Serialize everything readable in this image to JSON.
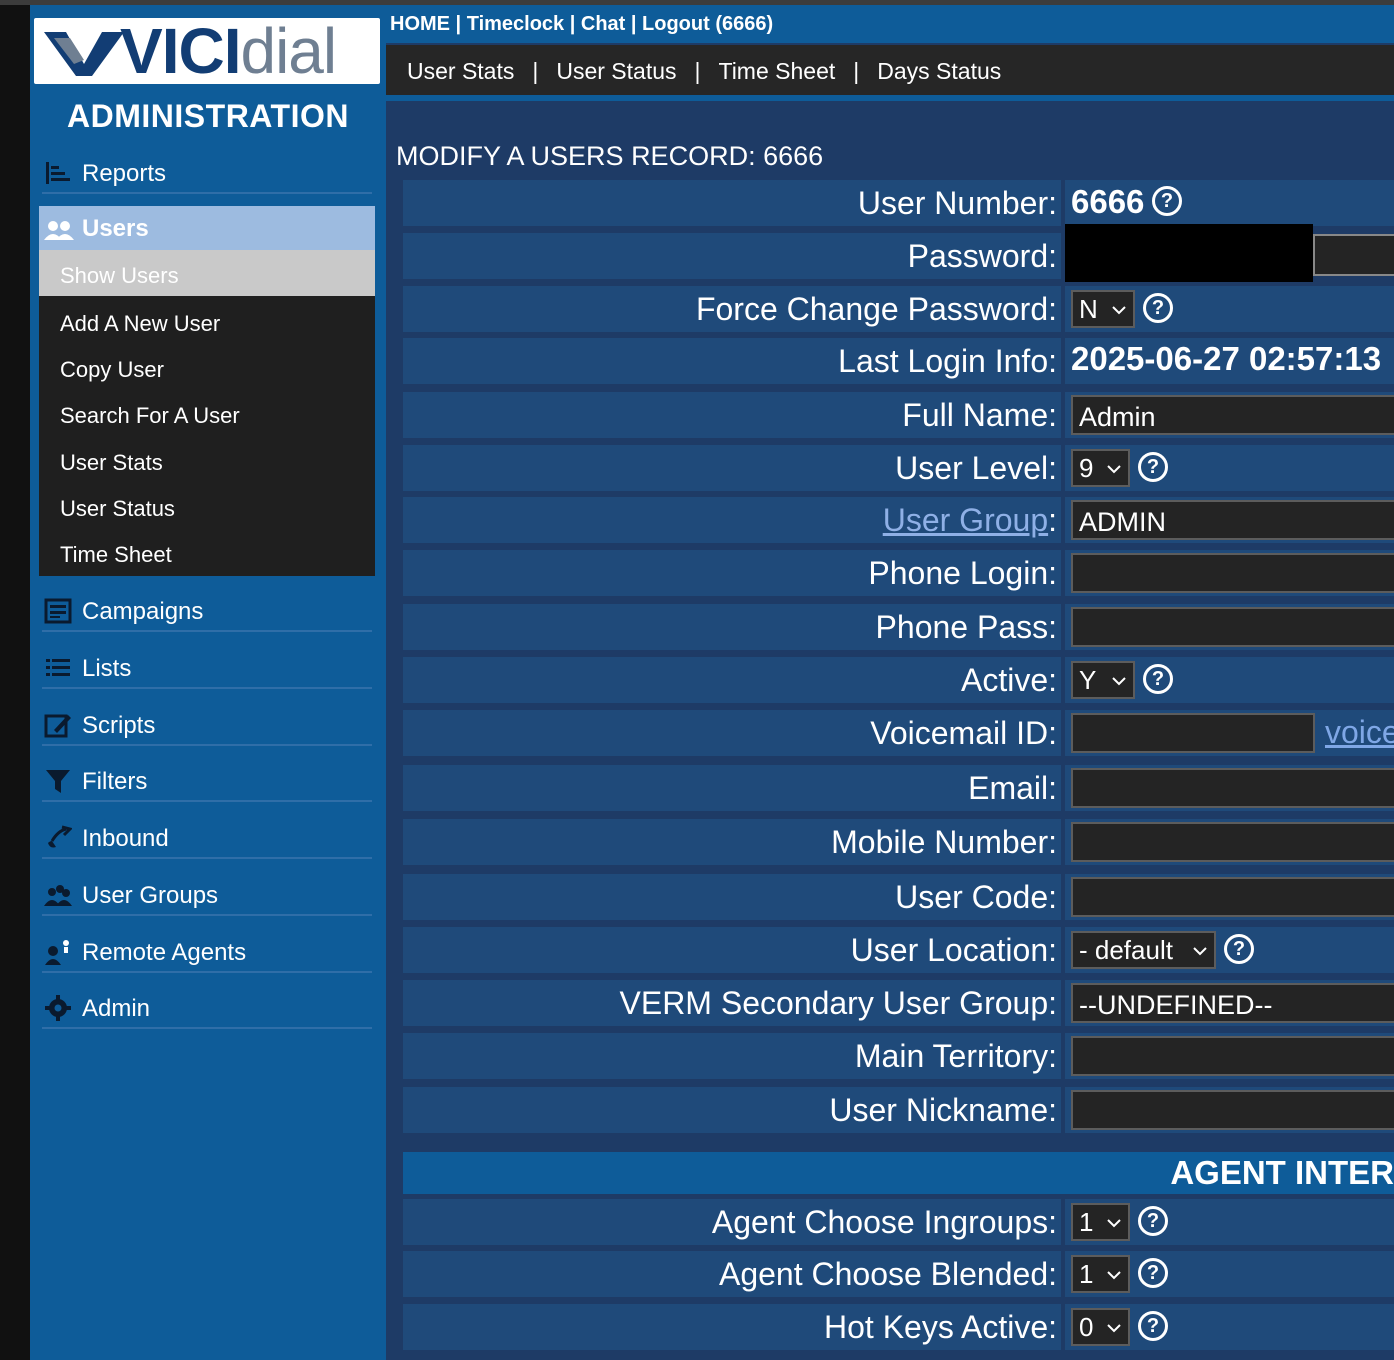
{
  "app": {
    "logo_text_vici": "VICI",
    "logo_text_dial": "dial",
    "admin_title": "ADMINISTRATION"
  },
  "topnav": {
    "text": "HOME | Timeclock | Chat | Logout (6666)"
  },
  "subnav": {
    "items": [
      "User Stats",
      "User Status",
      "Time Sheet",
      "Days Status"
    ],
    "separator": "|"
  },
  "sidebar": {
    "reports": "Reports",
    "users": "Users",
    "users_sub": [
      "Show Users",
      "Add A New User",
      "Copy User",
      "Search For A User",
      "User Stats",
      "User Status",
      "Time Sheet"
    ],
    "campaigns": "Campaigns",
    "lists": "Lists",
    "scripts": "Scripts",
    "filters": "Filters",
    "inbound": "Inbound",
    "user_groups": "User Groups",
    "remote_agents": "Remote Agents",
    "admin": "Admin"
  },
  "main": {
    "title": "MODIFY A USERS RECORD: 6666",
    "help_glyph": "?",
    "fields": {
      "user_number": {
        "label": "User Number:",
        "value": "6666"
      },
      "password": {
        "label": "Password:"
      },
      "force_change_password": {
        "label": "Force Change Password:",
        "value": "N"
      },
      "last_login_info": {
        "label": "Last Login Info:",
        "value": "2025-06-27 02:57:13"
      },
      "full_name": {
        "label": "Full Name:",
        "value": "Admin"
      },
      "user_level": {
        "label": "User Level:",
        "value": "9"
      },
      "user_group": {
        "label": "User Group",
        "colon": ":",
        "value": "ADMIN"
      },
      "phone_login": {
        "label": "Phone Login:",
        "value": ""
      },
      "phone_pass": {
        "label": "Phone Pass:",
        "value": ""
      },
      "active": {
        "label": "Active:",
        "value": "Y"
      },
      "voicemail_id": {
        "label": "Voicemail ID:",
        "value": "",
        "link": "voice"
      },
      "email": {
        "label": "Email:",
        "value": ""
      },
      "mobile_number": {
        "label": "Mobile Number:",
        "value": ""
      },
      "user_code": {
        "label": "User Code:",
        "value": ""
      },
      "user_location": {
        "label": "User Location:",
        "value": "- default"
      },
      "verm_secondary_user_group": {
        "label": "VERM Secondary User Group:",
        "value": "--UNDEFINED--"
      },
      "main_territory": {
        "label": "Main Territory:",
        "value": ""
      },
      "user_nickname": {
        "label": "User Nickname:",
        "value": ""
      }
    },
    "section_title": "AGENT INTER",
    "agent_fields": {
      "agent_choose_ingroups": {
        "label": "Agent Choose Ingroups:",
        "value": "1"
      },
      "agent_choose_blended": {
        "label": "Agent Choose Blended:",
        "value": "1"
      },
      "hot_keys_active": {
        "label": "Hot Keys Active:",
        "value": "0"
      }
    }
  },
  "colors": {
    "sidebar_blue": "#0e5c99",
    "panel_blue": "#1f4a7a",
    "page_blue": "#1e3b66",
    "users_header": "#9dbbe0",
    "link_blue": "#7fa7e6"
  },
  "icons": [
    "reports-icon",
    "users-icon",
    "campaigns-icon",
    "lists-icon",
    "scripts-icon",
    "filters-icon",
    "inbound-icon",
    "user-groups-icon",
    "remote-agents-icon",
    "admin-gear-icon",
    "help-icon",
    "chevron-down-icon"
  ]
}
